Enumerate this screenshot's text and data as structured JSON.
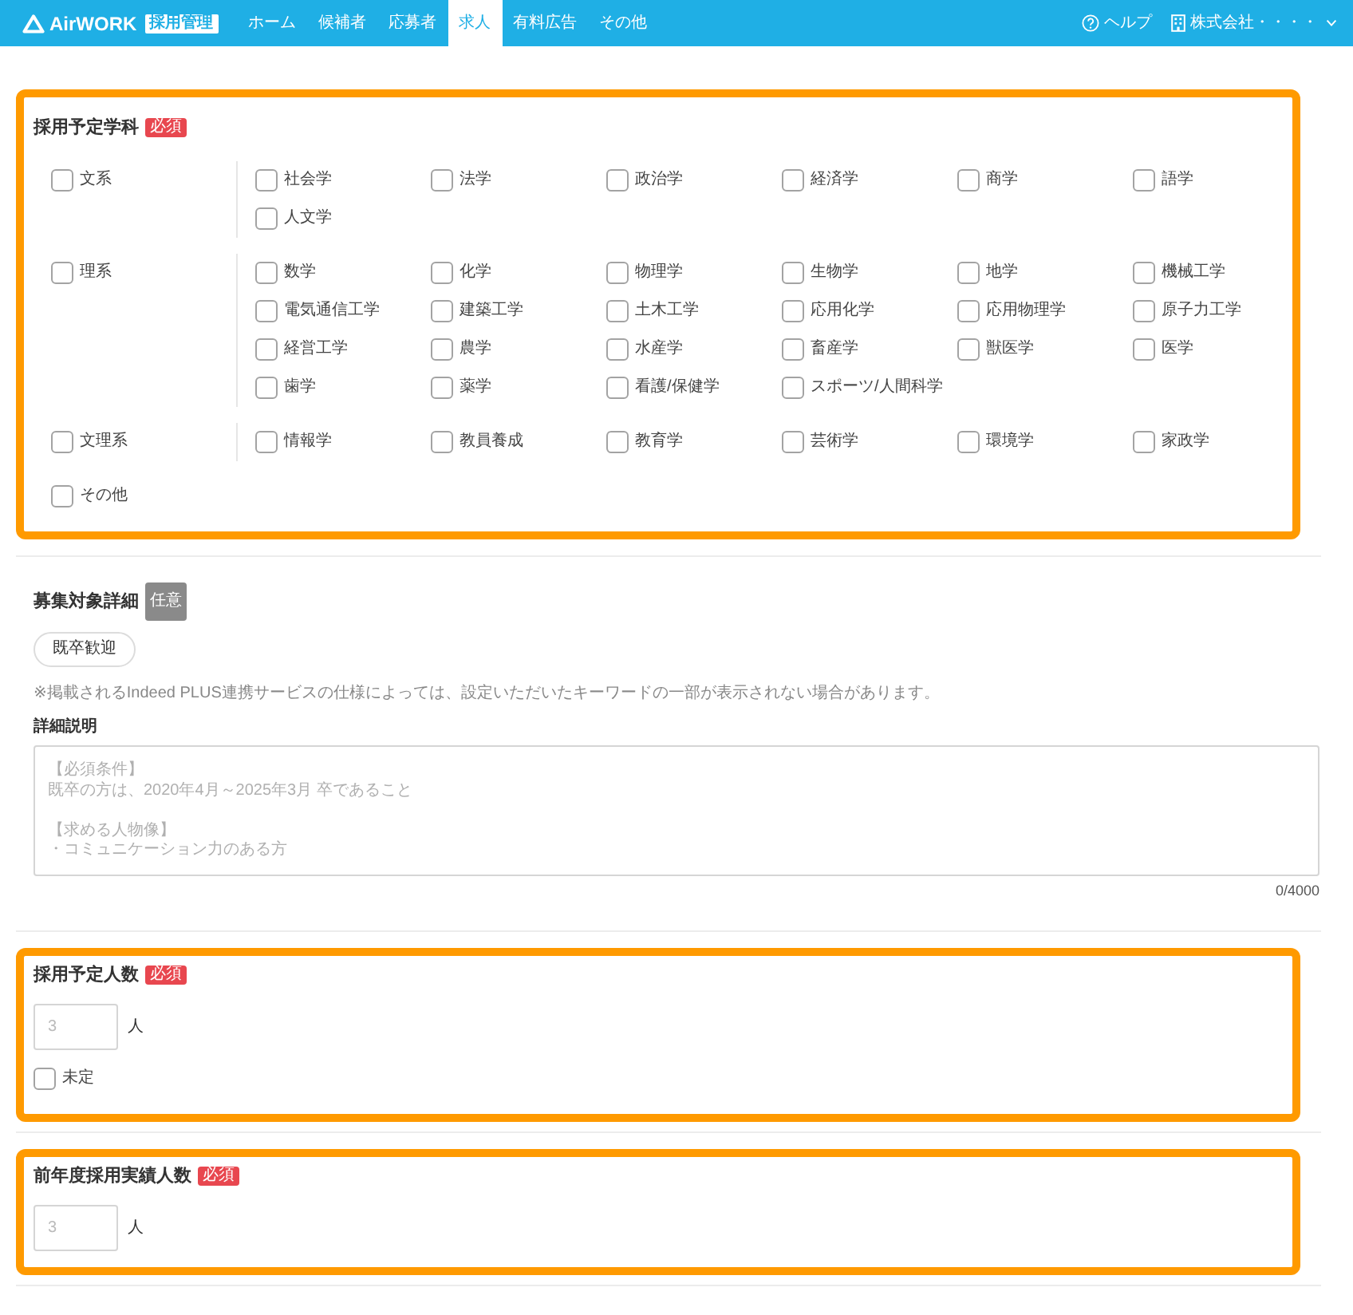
{
  "header": {
    "logo": "AirWORK",
    "logo_badge": "採用管理",
    "nav": [
      {
        "label": "ホーム",
        "selected": false
      },
      {
        "label": "候補者",
        "selected": false
      },
      {
        "label": "応募者",
        "selected": false
      },
      {
        "label": "求人",
        "selected": true
      },
      {
        "label": "有料広告",
        "selected": false
      },
      {
        "label": "その他",
        "selected": false
      }
    ],
    "help": "ヘルプ",
    "account": "株式会社・・・・"
  },
  "sections": [
    {
      "kind": "subjects",
      "highlighted": true,
      "title": "採用予定学科",
      "badge": {
        "text": "必須",
        "kind": "required"
      },
      "groups": [
        {
          "label": "文系",
          "checked": false,
          "children": [
            {
              "label": "社会学",
              "checked": false
            },
            {
              "label": "法学",
              "checked": false
            },
            {
              "label": "政治学",
              "checked": false
            },
            {
              "label": "経済学",
              "checked": false
            },
            {
              "label": "商学",
              "checked": false
            },
            {
              "label": "語学",
              "checked": false
            },
            {
              "label": "人文学",
              "checked": false
            }
          ]
        },
        {
          "label": "理系",
          "checked": false,
          "children": [
            {
              "label": "数学",
              "checked": false
            },
            {
              "label": "化学",
              "checked": false
            },
            {
              "label": "物理学",
              "checked": false
            },
            {
              "label": "生物学",
              "checked": false
            },
            {
              "label": "地学",
              "checked": false
            },
            {
              "label": "機械工学",
              "checked": false
            },
            {
              "label": "電気通信工学",
              "checked": false
            },
            {
              "label": "建築工学",
              "checked": false
            },
            {
              "label": "土木工学",
              "checked": false
            },
            {
              "label": "応用化学",
              "checked": false
            },
            {
              "label": "応用物理学",
              "checked": false
            },
            {
              "label": "原子力工学",
              "checked": false
            },
            {
              "label": "経営工学",
              "checked": false
            },
            {
              "label": "農学",
              "checked": false
            },
            {
              "label": "水産学",
              "checked": false
            },
            {
              "label": "畜産学",
              "checked": false
            },
            {
              "label": "獣医学",
              "checked": false
            },
            {
              "label": "医学",
              "checked": false
            },
            {
              "label": "歯学",
              "checked": false
            },
            {
              "label": "薬学",
              "checked": false
            },
            {
              "label": "看護/保健学",
              "checked": false
            },
            {
              "label": "スポーツ/人間科学",
              "checked": false
            }
          ]
        },
        {
          "label": "文理系",
          "checked": false,
          "children": [
            {
              "label": "情報学",
              "checked": false
            },
            {
              "label": "教員養成",
              "checked": false
            },
            {
              "label": "教育学",
              "checked": false
            },
            {
              "label": "芸術学",
              "checked": false
            },
            {
              "label": "環境学",
              "checked": false
            },
            {
              "label": "家政学",
              "checked": false
            }
          ]
        },
        {
          "label": "その他",
          "checked": false
        }
      ]
    },
    {
      "kind": "details",
      "title": "募集対象詳細",
      "badge": {
        "text": "任意",
        "kind": "optional"
      },
      "chips": [
        {
          "label": "既卒歓迎",
          "selected": false
        }
      ],
      "note": "※掲載されるIndeed PLUS連携サービスの仕様によっては、設定いただいたキーワードの一部が表示されない場合があります。",
      "field_label": "詳細説明",
      "textarea": {
        "placeholder_blocks": [
          [
            "【必須条件】",
            "既卒の方は、2020年4月～2025年3月 卒であること"
          ],
          [
            "【求める人物像】",
            "・コミュニケーション力のある方"
          ]
        ],
        "counter": "0/4000"
      }
    },
    {
      "kind": "count",
      "highlighted": true,
      "title": "採用予定人数",
      "badge": {
        "text": "必須",
        "kind": "required"
      },
      "input": {
        "placeholder": "3"
      },
      "unit": "人",
      "options": [
        {
          "label": "未定",
          "checked": false
        }
      ]
    },
    {
      "kind": "count",
      "highlighted": true,
      "title": "前年度採用実績人数",
      "badge": {
        "text": "必須",
        "kind": "required"
      },
      "input": {
        "placeholder": "3"
      },
      "unit": "人"
    }
  ]
}
